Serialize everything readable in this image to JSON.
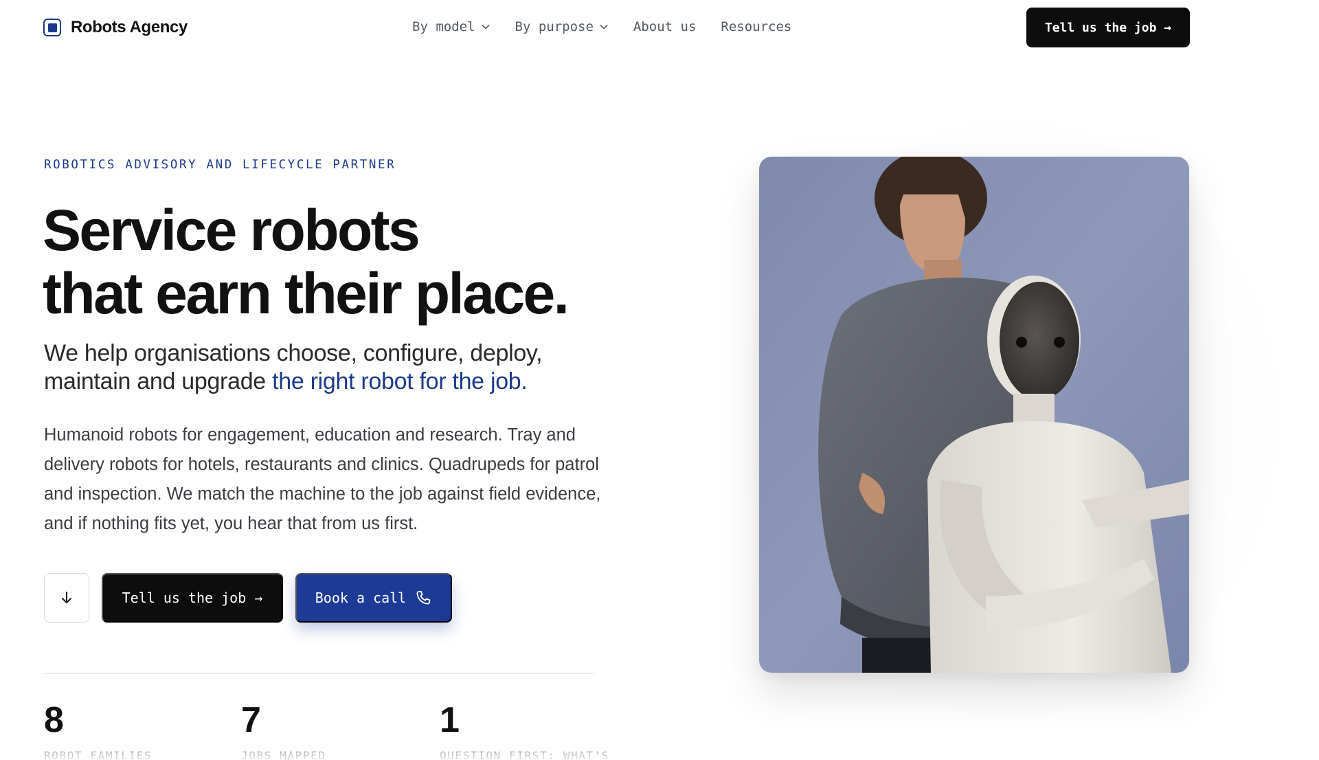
{
  "brand": {
    "name": "Robots Agency"
  },
  "nav": {
    "items": [
      {
        "label": "By model",
        "has_dropdown": true
      },
      {
        "label": "By purpose",
        "has_dropdown": true
      },
      {
        "label": "About us",
        "has_dropdown": false
      },
      {
        "label": "Resources",
        "has_dropdown": false
      }
    ],
    "cta_label": "Tell us the job →"
  },
  "hero": {
    "eyebrow": "ROBOTICS ADVISORY AND LIFECYCLE PARTNER",
    "headline_line1": "Service robots",
    "headline_line2": "that earn their place.",
    "lead_plain": "We help organisations choose, configure, deploy, maintain and upgrade ",
    "lead_accent": "the right robot for the job.",
    "body": "Humanoid robots for engagement, education and research. Tray and delivery robots for hotels, restaurants and clinics. Quadrupeds for patrol and inspection. We match the machine to the job against field evidence, and if nothing fits yet, you hear that from us first.",
    "primary_cta": "Tell us the job →",
    "secondary_cta": "Book a call",
    "scroll_icon": "arrow-down-icon",
    "phone_icon": "phone-icon"
  },
  "stats": [
    {
      "value": "8",
      "label": "ROBOT FAMILIES"
    },
    {
      "value": "7",
      "label": "JOBS MAPPED"
    },
    {
      "value": "1",
      "label": "QUESTION FIRST: WHAT'S"
    }
  ],
  "colors": {
    "accent": "#1d3a8a",
    "button_blue": "#1c3a96",
    "button_dark": "#0d0d0d",
    "text": "#141414",
    "muted": "#555a60"
  }
}
